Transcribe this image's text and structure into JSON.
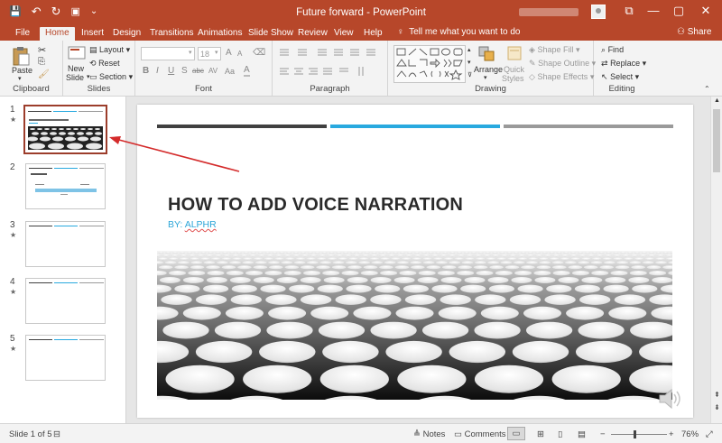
{
  "window": {
    "title": "Future forward  -  PowerPoint",
    "minimize_glyph": "—",
    "restore_glyph": "▢",
    "close_glyph": "✕",
    "ribbon_options_glyph": "⧉"
  },
  "qat": {
    "save": "💾",
    "undo": "↶",
    "redo": "↻",
    "present": "▣",
    "more": "⌄"
  },
  "tabs": [
    "File",
    "Home",
    "Insert",
    "Design",
    "Transitions",
    "Animations",
    "Slide Show",
    "Review",
    "View",
    "Help"
  ],
  "active_tab": "Home",
  "tell_me": "Tell me what you want to do",
  "share": "Share",
  "ribbon": {
    "clipboard": {
      "label": "Clipboard",
      "paste": "Paste"
    },
    "slides": {
      "label": "Slides",
      "new_slide_line1": "New",
      "new_slide_line2": "Slide",
      "layout": "Layout",
      "reset": "Reset",
      "section": "Section"
    },
    "font": {
      "label": "Font",
      "size": "18",
      "bold": "B",
      "italic": "I",
      "underline": "U",
      "strike": "S",
      "abc": "abc",
      "av": "AV",
      "aa": "Aa",
      "grow": "A",
      "shrink": "A"
    },
    "paragraph": {
      "label": "Paragraph"
    },
    "drawing": {
      "label": "Drawing",
      "arrange": "Arrange",
      "quick_styles_1": "Quick",
      "quick_styles_2": "Styles",
      "shape_fill": "Shape Fill",
      "shape_outline": "Shape Outline",
      "shape_effects": "Shape Effects"
    },
    "editing": {
      "label": "Editing",
      "find": "Find",
      "replace": "Replace",
      "select": "Select"
    }
  },
  "slides_pane": [
    {
      "number": "1",
      "star": "★"
    },
    {
      "number": "2",
      "star": ""
    },
    {
      "number": "3",
      "star": "★"
    },
    {
      "number": "4",
      "star": "★"
    },
    {
      "number": "5",
      "star": "★"
    }
  ],
  "slide": {
    "title": "HOW TO ADD VOICE NARRATION",
    "subtitle_prefix": "BY: ",
    "subtitle_name": "ALPHR",
    "bar_colors": [
      "#404040",
      "#29a9df",
      "#9a9a9a"
    ]
  },
  "status": {
    "slide_counter": "Slide 1 of 5",
    "notes": "Notes",
    "comments": "Comments",
    "zoom": "76%"
  },
  "colors": {
    "accent": "#b7472a",
    "annotation": "#d42b2b"
  }
}
